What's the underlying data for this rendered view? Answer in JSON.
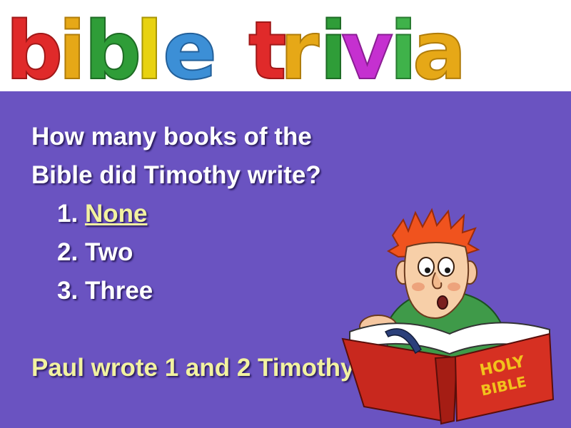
{
  "header": {
    "logo_text": "bible trivia",
    "letter_colors": [
      "#e02a2a",
      "#e6a817",
      "#2f9d38",
      "#e8d20f",
      "#3c8fd6",
      "#e02a2a",
      "#e6a817",
      "#2f9d38",
      "#c530d0",
      "#3fb24a",
      "#e6a817"
    ]
  },
  "slide": {
    "background": "#6a53c1",
    "question_line1": "How many books of the",
    "question_line2": "Bible did Timothy write?",
    "options": [
      {
        "number": "1.",
        "label": "None"
      },
      {
        "number": "2.",
        "label": "Two"
      },
      {
        "number": "3.",
        "label": "Three"
      }
    ],
    "answer_note": "Paul wrote 1 and 2 Timothy",
    "book_cover_text": [
      "HOLY",
      "BIBLE"
    ]
  }
}
